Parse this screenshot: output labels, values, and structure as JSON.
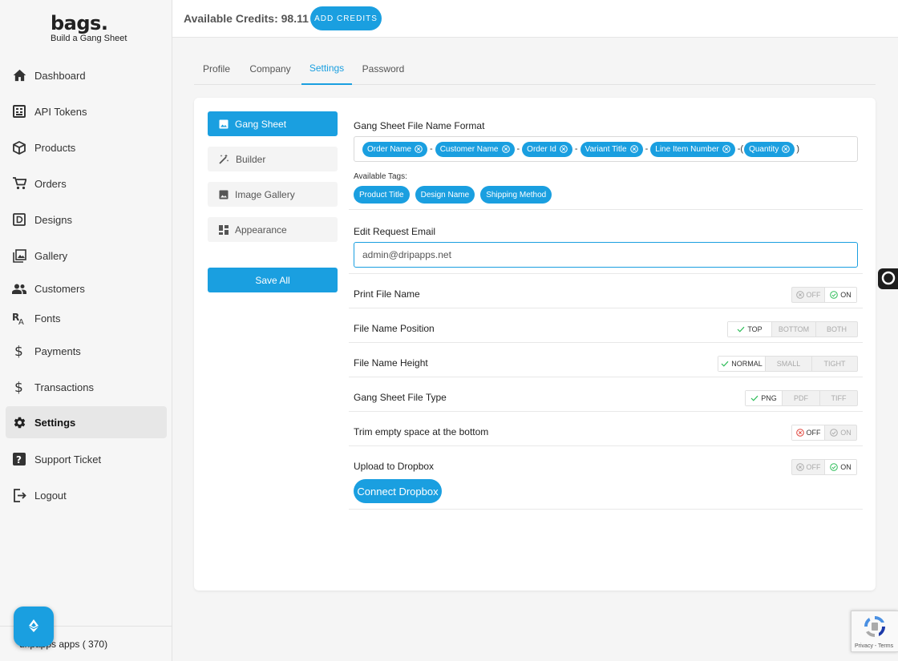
{
  "brand": {
    "name": "bags.",
    "tagline": "Build a Gang Sheet"
  },
  "sidebar": {
    "items": [
      {
        "label": "Dashboard",
        "icon": "home-icon"
      },
      {
        "label": "API Tokens",
        "icon": "api-icon"
      },
      {
        "label": "Products",
        "icon": "box-icon"
      },
      {
        "label": "Orders",
        "icon": "cart-icon"
      },
      {
        "label": "Designs",
        "icon": "designs-icon"
      },
      {
        "label": "Gallery",
        "icon": "gallery-icon"
      },
      {
        "label": "Customers",
        "icon": "users-icon"
      },
      {
        "label": "Fonts",
        "icon": "font-icon"
      },
      {
        "label": "Payments",
        "icon": "dollar-icon"
      },
      {
        "label": "Transactions",
        "icon": "dollar-icon"
      },
      {
        "label": "Settings",
        "icon": "gear-icon",
        "active": true
      },
      {
        "label": "Support Ticket",
        "icon": "question-icon"
      },
      {
        "label": "Logout",
        "icon": "logout-icon"
      }
    ],
    "footer": "dripapps apps ( 370)"
  },
  "header": {
    "credits_label": "Available Credits: 98.11",
    "add_credits": "ADD CREDITS"
  },
  "tabs": [
    {
      "label": "Profile"
    },
    {
      "label": "Company"
    },
    {
      "label": "Settings",
      "active": true
    },
    {
      "label": "Password"
    }
  ],
  "subnav": {
    "items": [
      {
        "label": "Gang Sheet",
        "icon": "image-icon",
        "active": true
      },
      {
        "label": "Builder",
        "icon": "magic-wand-icon"
      },
      {
        "label": "Image Gallery",
        "icon": "image-icon"
      },
      {
        "label": "Appearance",
        "icon": "dashboard-icon"
      }
    ],
    "save_all": "Save All"
  },
  "settings": {
    "file_name_format": {
      "label": "Gang Sheet File Name Format",
      "tags": [
        "Order Name",
        "Customer Name",
        "Order Id",
        "Variant Title",
        "Line Item Number",
        "Quantity"
      ],
      "separator": "-",
      "open_paren": "(",
      "close_paren": ")"
    },
    "available_tags_label": "Available Tags:",
    "available_tags": [
      "Product Title",
      "Design Name",
      "Shipping Method"
    ],
    "edit_request_email": {
      "label": "Edit Request Email",
      "value": "admin@dripapps.net"
    },
    "print_file_name": {
      "label": "Print File Name",
      "options": [
        "OFF",
        "ON"
      ],
      "selected": "ON"
    },
    "file_name_position": {
      "label": "File Name Position",
      "options": [
        "TOP",
        "BOTTOM",
        "BOTH"
      ],
      "selected": "TOP"
    },
    "file_name_height": {
      "label": "File Name Height",
      "options": [
        "NORMAL",
        "SMALL",
        "TIGHT"
      ],
      "selected": "NORMAL"
    },
    "file_type": {
      "label": "Gang Sheet File Type",
      "options": [
        "PNG",
        "PDF",
        "TIFF"
      ],
      "selected": "PNG"
    },
    "trim_empty": {
      "label": "Trim empty space at the bottom",
      "options": [
        "OFF",
        "ON"
      ],
      "selected": "OFF"
    },
    "upload_dropbox": {
      "label": "Upload to Dropbox",
      "options": [
        "OFF",
        "ON"
      ],
      "selected": "ON"
    },
    "connect_dropbox": "Connect Dropbox"
  },
  "recaptcha": {
    "text": "Privacy - Terms"
  },
  "colors": {
    "accent": "#1a9fe0",
    "success": "#2ebd59",
    "danger": "#e0433a"
  }
}
